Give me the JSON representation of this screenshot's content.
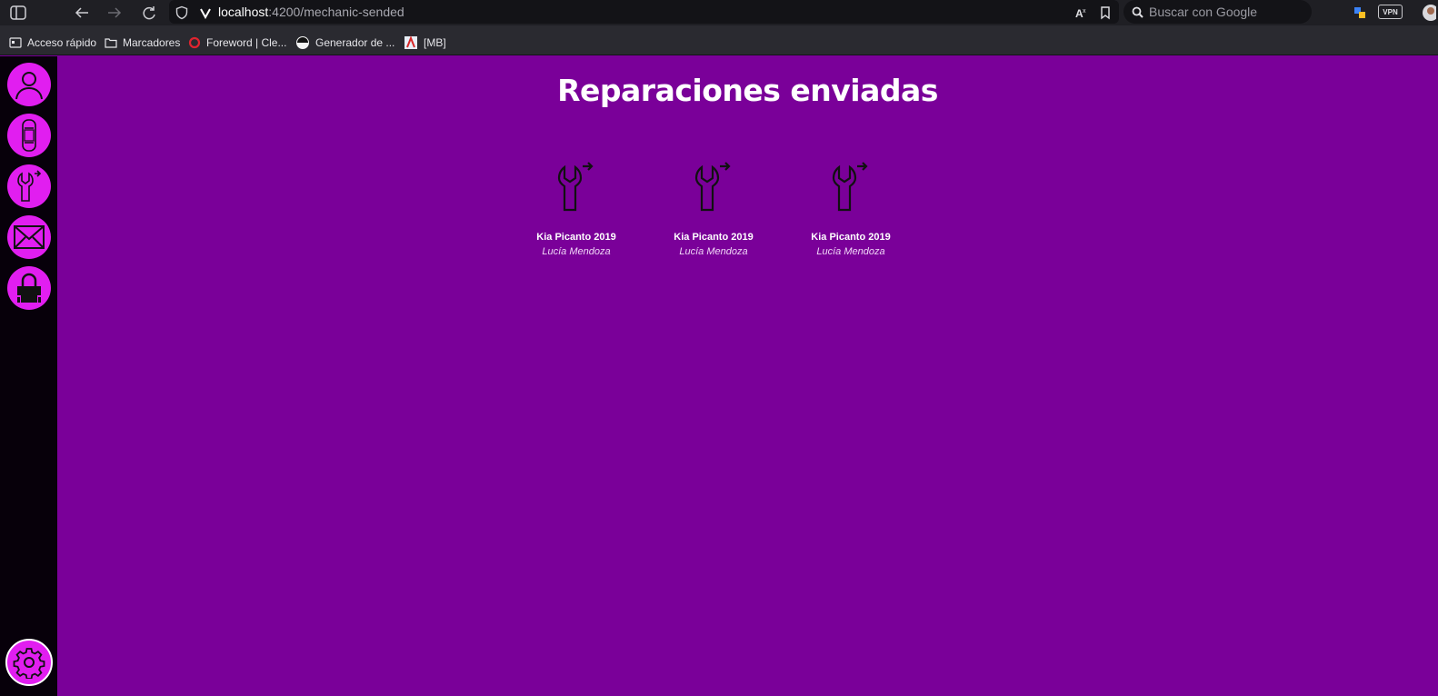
{
  "browser": {
    "url_host": "localhost",
    "url_path": ":4200/mechanic-sended",
    "search_placeholder": "Buscar con Google",
    "vpn_label": "VPN",
    "bookmarks": [
      {
        "label": "Acceso rápido",
        "icon": "quick-access-icon"
      },
      {
        "label": "Marcadores",
        "icon": "folder-icon"
      },
      {
        "label": "Foreword | Cle...",
        "icon": "opera-icon"
      },
      {
        "label": "Generador de ...",
        "icon": "avatar-icon"
      },
      {
        "label": "[MB]",
        "icon": "mb-icon"
      }
    ]
  },
  "sidebar": {
    "items": [
      {
        "name": "profile",
        "icon": "user-icon"
      },
      {
        "name": "cars",
        "icon": "car-icon"
      },
      {
        "name": "repairs-sent",
        "icon": "wrench-send-icon"
      },
      {
        "name": "messages",
        "icon": "mail-icon"
      },
      {
        "name": "lock",
        "icon": "lock-icon"
      }
    ],
    "settings_icon": "gear-icon"
  },
  "main": {
    "title": "Reparaciones enviadas",
    "repairs": [
      {
        "model": "Kia Picanto 2019",
        "owner": "Lucía Mendoza"
      },
      {
        "model": "Kia Picanto 2019",
        "owner": "Lucía Mendoza"
      },
      {
        "model": "Kia Picanto 2019",
        "owner": "Lucía Mendoza"
      }
    ]
  },
  "colors": {
    "background": "#7a0099",
    "sidebar": "#07000a",
    "accent": "#e11ef0"
  }
}
